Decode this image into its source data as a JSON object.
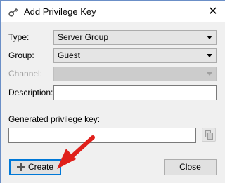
{
  "window": {
    "title": "Add Privilege Key",
    "close_symbol": "✕"
  },
  "form": {
    "type": {
      "label": "Type:",
      "value": "Server Group"
    },
    "group": {
      "label": "Group:",
      "value": "Guest"
    },
    "channel": {
      "label": "Channel:",
      "value": ""
    },
    "description": {
      "label": "Description:",
      "value": ""
    },
    "generated_key": {
      "label": "Generated privilege key:",
      "value": ""
    }
  },
  "buttons": {
    "create": "Create",
    "close": "Close"
  },
  "colors": {
    "annotation_arrow": "#e0201b",
    "focus_border": "#0078d7"
  }
}
